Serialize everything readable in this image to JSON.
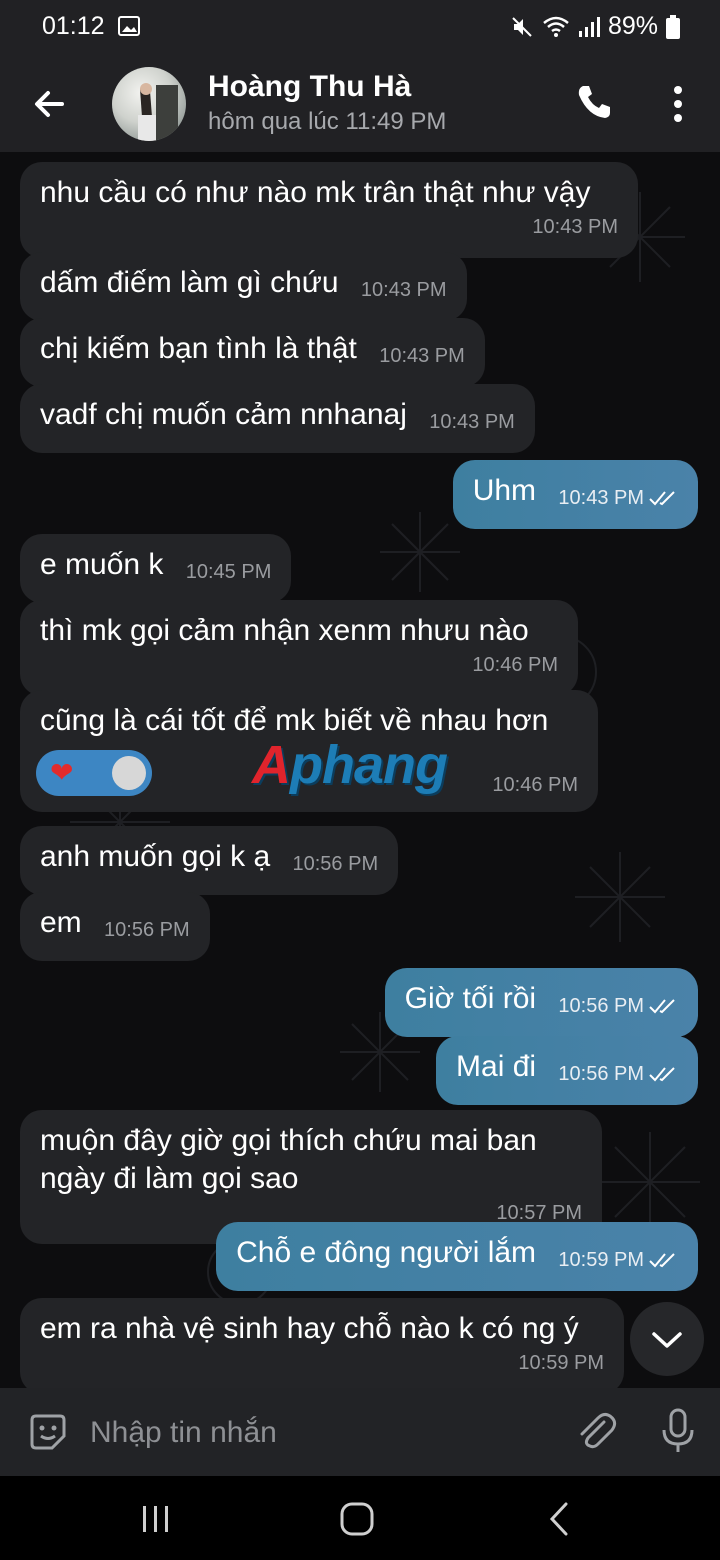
{
  "status_bar": {
    "time": "01:12",
    "battery": "89%"
  },
  "header": {
    "contact_name": "Hoàng Thu Hà",
    "last_seen": "hôm qua lúc 11:49 PM"
  },
  "messages": [
    {
      "dir": "in",
      "text": "nhu cầu có như nào mk trân thật như vậy",
      "time": "10:43 PM"
    },
    {
      "dir": "in",
      "text": "dấm điếm làm gì chứu",
      "time": "10:43 PM"
    },
    {
      "dir": "in",
      "text": "chị kiếm bạn tình là thật",
      "time": "10:43 PM"
    },
    {
      "dir": "in",
      "text": "vadf chị muốn cảm nnhanaj",
      "time": "10:43 PM"
    },
    {
      "dir": "out",
      "text": "Uhm",
      "time": "10:43 PM"
    },
    {
      "dir": "in",
      "text": "e muốn k",
      "time": "10:45 PM"
    },
    {
      "dir": "in",
      "text": "thì mk gọi cảm nhận xenm nhưu nào",
      "time": "10:46 PM"
    },
    {
      "dir": "in",
      "text": "cũng là cái tốt để mk biết về nhau hơn",
      "time": "10:46 PM",
      "watermark": "Aphang"
    },
    {
      "dir": "in",
      "text": "anh muốn gọi k ạ",
      "time": "10:56 PM"
    },
    {
      "dir": "in",
      "text": "em",
      "time": "10:56 PM"
    },
    {
      "dir": "out",
      "text": "Giờ tối rồi",
      "time": "10:56 PM"
    },
    {
      "dir": "out",
      "text": "Mai đi",
      "time": "10:56 PM"
    },
    {
      "dir": "in",
      "text": "muộn đây giờ  gọi thích chứu mai ban ngày đi làm gọi sao",
      "time": "10:57 PM"
    },
    {
      "dir": "out",
      "text": "Chỗ e đông người lắm",
      "time": "10:59 PM"
    },
    {
      "dir": "in",
      "text": "em ra nhà vệ sinh hay chỗ nào k có ng ý",
      "time": "10:59 PM"
    }
  ],
  "input": {
    "placeholder": "Nhập tin nhắn",
    "value": ""
  },
  "colors": {
    "outgoing_bubble": "#4a82a9",
    "incoming_bubble": "#232427",
    "reaction": "#3d86c3"
  },
  "icons": [
    "back-arrow-icon",
    "phone-icon",
    "more-vert-icon",
    "sticker-icon",
    "attach-icon",
    "mic-icon",
    "chevron-down-icon",
    "read-check-icon",
    "heart-icon"
  ]
}
